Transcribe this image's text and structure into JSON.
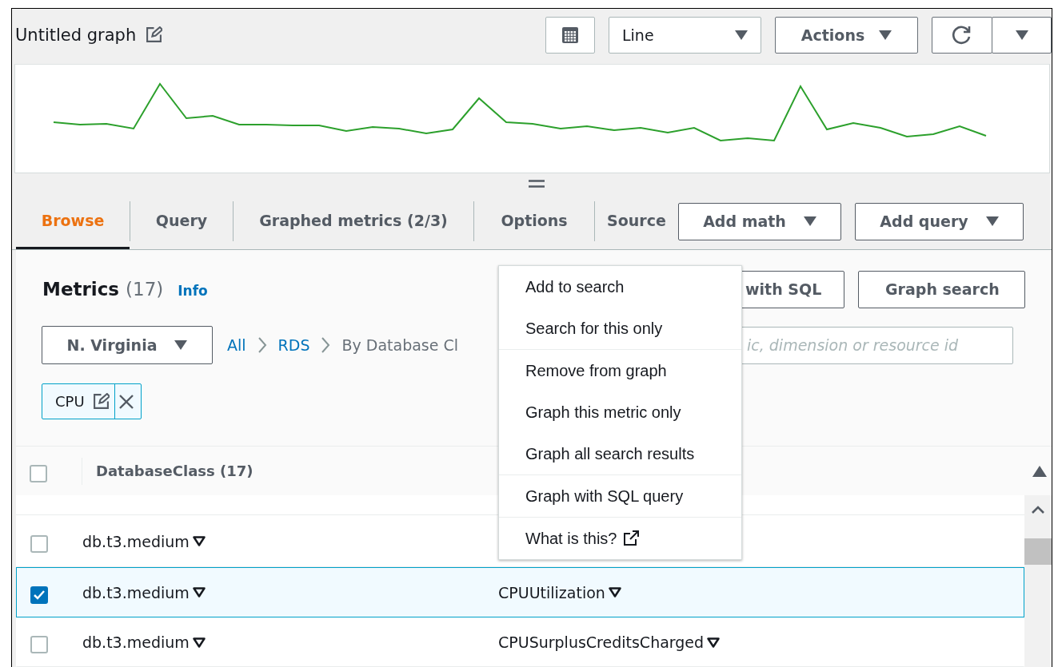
{
  "graph": {
    "title": "Untitled graph"
  },
  "toolbar": {
    "chart_type": "Line",
    "actions": "Actions"
  },
  "tabs": [
    {
      "label": "Browse",
      "selected": true
    },
    {
      "label": "Query",
      "selected": false
    },
    {
      "label": "Graphed metrics (2/3)",
      "selected": false
    },
    {
      "label": "Options",
      "selected": false
    },
    {
      "label": "Source",
      "selected": false
    }
  ],
  "tab_buttons": [
    "Add math",
    "Add query"
  ],
  "metrics": {
    "title": "Metrics",
    "count": "(17)",
    "info": "Info",
    "buttons": [
      "with SQL",
      "Graph search"
    ]
  },
  "filters": {
    "region": "N. Virginia",
    "breadcrumb": [
      {
        "label": "All",
        "link": true
      },
      {
        "label": "RDS",
        "link": true
      },
      {
        "label": "By Database Cl",
        "link": false
      }
    ],
    "search": {
      "placeholder": "ic, dimension or resource id"
    }
  },
  "chips": [
    {
      "label": "CPU"
    }
  ],
  "table": {
    "all_checked": false,
    "columns": [
      "DatabaseClass (17)"
    ],
    "rows": [
      {
        "database_class": "db.t3.medium",
        "selected": false
      },
      {
        "database_class": "db.t3.medium",
        "metric": "CPUUtilization",
        "selected": true
      },
      {
        "database_class": "db.t3.medium",
        "metric": "CPUSurplusCreditsCharged",
        "selected": false
      }
    ]
  },
  "context_menu": {
    "sections": [
      [
        {
          "label": "Add to search",
          "external": false
        },
        {
          "label": "Search for this only",
          "external": false
        }
      ],
      [
        {
          "label": "Remove from graph",
          "external": false
        },
        {
          "label": "Graph this metric only",
          "external": false
        },
        {
          "label": "Graph all search results",
          "external": false
        }
      ],
      [
        {
          "label": "Graph with SQL query",
          "external": false
        }
      ],
      [
        {
          "label": "What is this?",
          "external": true
        }
      ]
    ]
  }
}
